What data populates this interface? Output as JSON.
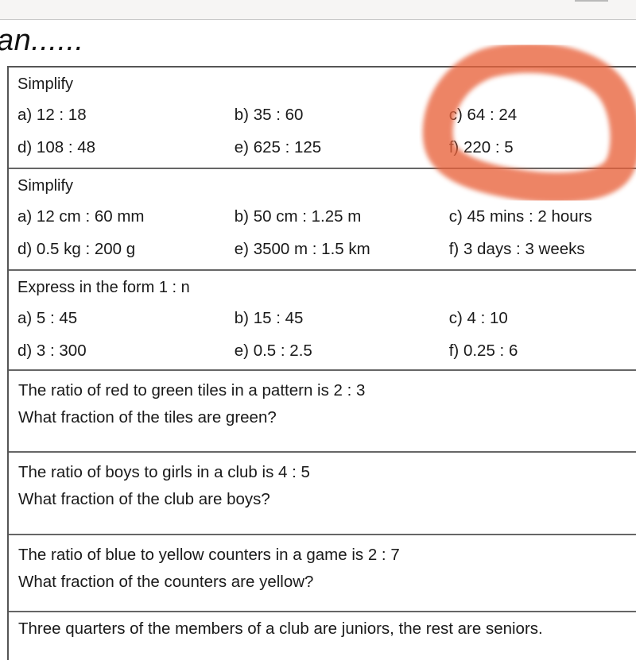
{
  "heading": "an......",
  "annotation": {
    "color": "#e8623a",
    "shape": "freehand-circle"
  },
  "sections": [
    {
      "title": "Simplify",
      "items": [
        [
          "a)  12 : 18",
          "b) 35 : 60",
          "c)  64 : 24"
        ],
        [
          "d)  108 : 48",
          "e)  625 : 125",
          "f)  220 : 5"
        ]
      ]
    },
    {
      "title": "Simplify",
      "items": [
        [
          "a)  12 cm : 60 mm",
          "b) 50 cm : 1.25 m",
          "c)  45 mins : 2 hours"
        ],
        [
          "d)  0.5 kg : 200 g",
          "e) 3500 m : 1.5 km",
          "f)  3 days : 3 weeks"
        ]
      ]
    },
    {
      "title": "Express in the form 1 : n",
      "items": [
        [
          "a)  5 : 45",
          "b)  15 : 45",
          "c)  4 : 10"
        ],
        [
          "d)  3 : 300",
          "e)  0.5 : 2.5",
          "f)   0.25 : 6"
        ]
      ]
    }
  ],
  "word_problems": [
    [
      "The ratio of red to green tiles in a pattern is 2 : 3",
      "What fraction of the tiles are green?"
    ],
    [
      "The ratio of boys to girls in a club is 4 : 5",
      "What fraction of the club are boys?"
    ],
    [
      "The ratio of blue to yellow counters in a game is 2 : 7",
      "What fraction of the counters are yellow?"
    ],
    [
      "Three quarters of the members of a club are juniors, the rest are seniors."
    ]
  ]
}
